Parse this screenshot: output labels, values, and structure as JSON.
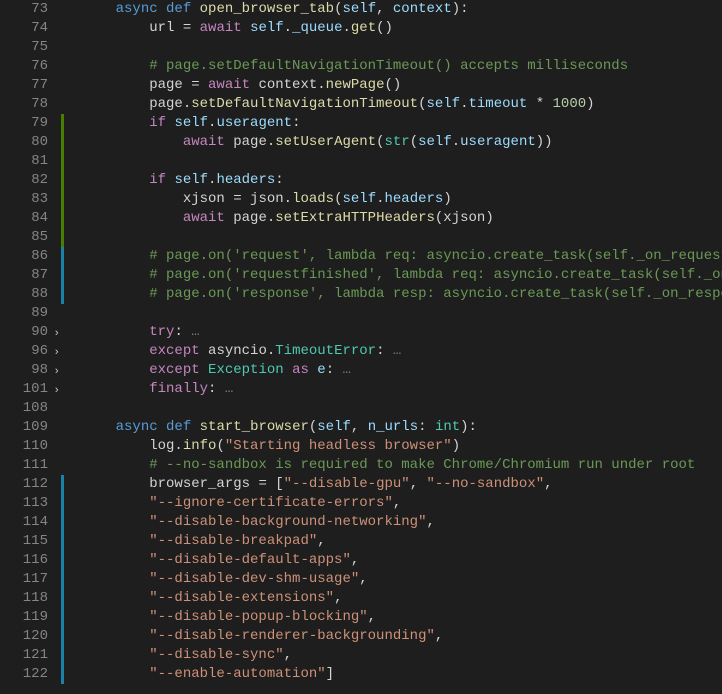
{
  "lines": [
    {
      "num": "73",
      "mod": null,
      "fold": false,
      "tokens": [
        {
          "t": "    ",
          "c": ""
        },
        {
          "t": "async",
          "c": "k-async"
        },
        {
          "t": " ",
          "c": ""
        },
        {
          "t": "def",
          "c": "k-def"
        },
        {
          "t": " ",
          "c": ""
        },
        {
          "t": "open_browser_tab",
          "c": "fn-name"
        },
        {
          "t": "(",
          "c": "punc"
        },
        {
          "t": "self",
          "c": "param"
        },
        {
          "t": ", ",
          "c": "punc"
        },
        {
          "t": "context",
          "c": "param"
        },
        {
          "t": "):",
          "c": "punc"
        }
      ]
    },
    {
      "num": "74",
      "mod": null,
      "fold": false,
      "tokens": [
        {
          "t": "        url ",
          "c": ""
        },
        {
          "t": "=",
          "c": "op"
        },
        {
          "t": " ",
          "c": ""
        },
        {
          "t": "await",
          "c": "k-ctrl"
        },
        {
          "t": " ",
          "c": ""
        },
        {
          "t": "self",
          "c": "k-self"
        },
        {
          "t": ".",
          "c": "punc"
        },
        {
          "t": "_queue",
          "c": "prop"
        },
        {
          "t": ".",
          "c": "punc"
        },
        {
          "t": "get",
          "c": "fn-call"
        },
        {
          "t": "()",
          "c": "punc"
        }
      ]
    },
    {
      "num": "75",
      "mod": null,
      "fold": false,
      "tokens": [
        {
          "t": "",
          "c": ""
        }
      ]
    },
    {
      "num": "76",
      "mod": null,
      "fold": false,
      "tokens": [
        {
          "t": "        ",
          "c": ""
        },
        {
          "t": "# page.setDefaultNavigationTimeout() accepts milliseconds",
          "c": "cmt"
        }
      ]
    },
    {
      "num": "77",
      "mod": null,
      "fold": false,
      "tokens": [
        {
          "t": "        page ",
          "c": ""
        },
        {
          "t": "=",
          "c": "op"
        },
        {
          "t": " ",
          "c": ""
        },
        {
          "t": "await",
          "c": "k-ctrl"
        },
        {
          "t": " context.",
          "c": ""
        },
        {
          "t": "newPage",
          "c": "fn-call"
        },
        {
          "t": "()",
          "c": "punc"
        }
      ]
    },
    {
      "num": "78",
      "mod": null,
      "fold": false,
      "tokens": [
        {
          "t": "        page.",
          "c": ""
        },
        {
          "t": "setDefaultNavigationTimeout",
          "c": "fn-call"
        },
        {
          "t": "(",
          "c": "punc"
        },
        {
          "t": "self",
          "c": "k-self"
        },
        {
          "t": ".",
          "c": "punc"
        },
        {
          "t": "timeout",
          "c": "prop"
        },
        {
          "t": " * ",
          "c": "op"
        },
        {
          "t": "1000",
          "c": "num"
        },
        {
          "t": ")",
          "c": "punc"
        }
      ]
    },
    {
      "num": "79",
      "mod": "green",
      "fold": false,
      "tokens": [
        {
          "t": "        ",
          "c": ""
        },
        {
          "t": "if",
          "c": "k-ctrl"
        },
        {
          "t": " ",
          "c": ""
        },
        {
          "t": "self",
          "c": "k-self"
        },
        {
          "t": ".",
          "c": "punc"
        },
        {
          "t": "useragent",
          "c": "prop"
        },
        {
          "t": ":",
          "c": "punc"
        }
      ]
    },
    {
      "num": "80",
      "mod": "green",
      "fold": false,
      "tokens": [
        {
          "t": "            ",
          "c": ""
        },
        {
          "t": "await",
          "c": "k-ctrl"
        },
        {
          "t": " page.",
          "c": ""
        },
        {
          "t": "setUserAgent",
          "c": "fn-call"
        },
        {
          "t": "(",
          "c": "punc"
        },
        {
          "t": "str",
          "c": "cls"
        },
        {
          "t": "(",
          "c": "punc"
        },
        {
          "t": "self",
          "c": "k-self"
        },
        {
          "t": ".",
          "c": "punc"
        },
        {
          "t": "useragent",
          "c": "prop"
        },
        {
          "t": "))",
          "c": "punc"
        }
      ]
    },
    {
      "num": "81",
      "mod": "green",
      "fold": false,
      "tokens": [
        {
          "t": "",
          "c": ""
        }
      ]
    },
    {
      "num": "82",
      "mod": "green",
      "fold": false,
      "tokens": [
        {
          "t": "        ",
          "c": ""
        },
        {
          "t": "if",
          "c": "k-ctrl"
        },
        {
          "t": " ",
          "c": ""
        },
        {
          "t": "self",
          "c": "k-self"
        },
        {
          "t": ".",
          "c": "punc"
        },
        {
          "t": "headers",
          "c": "prop"
        },
        {
          "t": ":",
          "c": "punc"
        }
      ]
    },
    {
      "num": "83",
      "mod": "green",
      "fold": false,
      "tokens": [
        {
          "t": "            xjson ",
          "c": ""
        },
        {
          "t": "=",
          "c": "op"
        },
        {
          "t": " json.",
          "c": ""
        },
        {
          "t": "loads",
          "c": "fn-call"
        },
        {
          "t": "(",
          "c": "punc"
        },
        {
          "t": "self",
          "c": "k-self"
        },
        {
          "t": ".",
          "c": "punc"
        },
        {
          "t": "headers",
          "c": "prop"
        },
        {
          "t": ")",
          "c": "punc"
        }
      ]
    },
    {
      "num": "84",
      "mod": "green",
      "fold": false,
      "tokens": [
        {
          "t": "            ",
          "c": ""
        },
        {
          "t": "await",
          "c": "k-ctrl"
        },
        {
          "t": " page.",
          "c": ""
        },
        {
          "t": "setExtraHTTPHeaders",
          "c": "fn-call"
        },
        {
          "t": "(xjson)",
          "c": "punc"
        }
      ]
    },
    {
      "num": "85",
      "mod": "green",
      "fold": false,
      "tokens": [
        {
          "t": "",
          "c": ""
        }
      ]
    },
    {
      "num": "86",
      "mod": "blue",
      "fold": false,
      "tokens": [
        {
          "t": "        ",
          "c": ""
        },
        {
          "t": "# page.on('request', lambda req: asyncio.create_task(self._on_request(",
          "c": "cmt"
        }
      ]
    },
    {
      "num": "87",
      "mod": "blue",
      "fold": false,
      "tokens": [
        {
          "t": "        ",
          "c": ""
        },
        {
          "t": "# page.on('requestfinished', lambda req: asyncio.create_task(self._on_",
          "c": "cmt"
        }
      ]
    },
    {
      "num": "88",
      "mod": "blue",
      "fold": false,
      "tokens": [
        {
          "t": "        ",
          "c": ""
        },
        {
          "t": "# page.on('response', lambda resp: asyncio.create_task(self._on_respons",
          "c": "cmt"
        }
      ]
    },
    {
      "num": "89",
      "mod": null,
      "fold": false,
      "tokens": [
        {
          "t": "",
          "c": ""
        }
      ]
    },
    {
      "num": "90",
      "mod": null,
      "fold": true,
      "tokens": [
        {
          "t": "        ",
          "c": ""
        },
        {
          "t": "try",
          "c": "k-ctrl"
        },
        {
          "t": ":",
          "c": "punc"
        },
        {
          "t": " …",
          "c": "collapse"
        }
      ]
    },
    {
      "num": "96",
      "mod": null,
      "fold": true,
      "tokens": [
        {
          "t": "        ",
          "c": ""
        },
        {
          "t": "except",
          "c": "k-ctrl"
        },
        {
          "t": " asyncio.",
          "c": ""
        },
        {
          "t": "TimeoutError",
          "c": "cls"
        },
        {
          "t": ":",
          "c": "punc"
        },
        {
          "t": " …",
          "c": "collapse"
        }
      ]
    },
    {
      "num": "98",
      "mod": null,
      "fold": true,
      "tokens": [
        {
          "t": "        ",
          "c": ""
        },
        {
          "t": "except",
          "c": "k-ctrl"
        },
        {
          "t": " ",
          "c": ""
        },
        {
          "t": "Exception",
          "c": "cls"
        },
        {
          "t": " ",
          "c": ""
        },
        {
          "t": "as",
          "c": "k-ctrl"
        },
        {
          "t": " ",
          "c": ""
        },
        {
          "t": "e",
          "c": "param"
        },
        {
          "t": ":",
          "c": "punc"
        },
        {
          "t": " …",
          "c": "collapse"
        }
      ]
    },
    {
      "num": "101",
      "mod": null,
      "fold": true,
      "tokens": [
        {
          "t": "        ",
          "c": ""
        },
        {
          "t": "finally",
          "c": "k-ctrl"
        },
        {
          "t": ":",
          "c": "punc"
        },
        {
          "t": " …",
          "c": "collapse"
        }
      ]
    },
    {
      "num": "108",
      "mod": null,
      "fold": false,
      "tokens": [
        {
          "t": "",
          "c": ""
        }
      ]
    },
    {
      "num": "109",
      "mod": null,
      "fold": false,
      "tokens": [
        {
          "t": "    ",
          "c": ""
        },
        {
          "t": "async",
          "c": "k-async"
        },
        {
          "t": " ",
          "c": ""
        },
        {
          "t": "def",
          "c": "k-def"
        },
        {
          "t": " ",
          "c": ""
        },
        {
          "t": "start_browser",
          "c": "fn-name"
        },
        {
          "t": "(",
          "c": "punc"
        },
        {
          "t": "self",
          "c": "param"
        },
        {
          "t": ", ",
          "c": "punc"
        },
        {
          "t": "n_urls",
          "c": "param"
        },
        {
          "t": ": ",
          "c": "punc"
        },
        {
          "t": "int",
          "c": "cls"
        },
        {
          "t": "):",
          "c": "punc"
        }
      ]
    },
    {
      "num": "110",
      "mod": null,
      "fold": false,
      "tokens": [
        {
          "t": "        log.",
          "c": ""
        },
        {
          "t": "info",
          "c": "fn-call"
        },
        {
          "t": "(",
          "c": "punc"
        },
        {
          "t": "\"Starting headless browser\"",
          "c": "str"
        },
        {
          "t": ")",
          "c": "punc"
        }
      ]
    },
    {
      "num": "111",
      "mod": null,
      "fold": false,
      "tokens": [
        {
          "t": "        ",
          "c": ""
        },
        {
          "t": "# --no-sandbox is required to make Chrome/Chromium run under root",
          "c": "cmt"
        }
      ]
    },
    {
      "num": "112",
      "mod": "blue",
      "fold": false,
      "tokens": [
        {
          "t": "        browser_args ",
          "c": ""
        },
        {
          "t": "=",
          "c": "op"
        },
        {
          "t": " [",
          "c": "punc"
        },
        {
          "t": "\"--disable-gpu\"",
          "c": "str"
        },
        {
          "t": ", ",
          "c": "punc"
        },
        {
          "t": "\"--no-sandbox\"",
          "c": "str"
        },
        {
          "t": ",",
          "c": "punc"
        }
      ]
    },
    {
      "num": "113",
      "mod": "blue",
      "fold": false,
      "tokens": [
        {
          "t": "        ",
          "c": ""
        },
        {
          "t": "\"--ignore-certificate-errors\"",
          "c": "str"
        },
        {
          "t": ",",
          "c": "punc"
        }
      ]
    },
    {
      "num": "114",
      "mod": "blue",
      "fold": false,
      "tokens": [
        {
          "t": "        ",
          "c": ""
        },
        {
          "t": "\"--disable-background-networking\"",
          "c": "str"
        },
        {
          "t": ",",
          "c": "punc"
        }
      ]
    },
    {
      "num": "115",
      "mod": "blue",
      "fold": false,
      "tokens": [
        {
          "t": "        ",
          "c": ""
        },
        {
          "t": "\"--disable-breakpad\"",
          "c": "str"
        },
        {
          "t": ",",
          "c": "punc"
        }
      ]
    },
    {
      "num": "116",
      "mod": "blue",
      "fold": false,
      "tokens": [
        {
          "t": "        ",
          "c": ""
        },
        {
          "t": "\"--disable-default-apps\"",
          "c": "str"
        },
        {
          "t": ",",
          "c": "punc"
        }
      ]
    },
    {
      "num": "117",
      "mod": "blue",
      "fold": false,
      "tokens": [
        {
          "t": "        ",
          "c": ""
        },
        {
          "t": "\"--disable-dev-shm-usage\"",
          "c": "str"
        },
        {
          "t": ",",
          "c": "punc"
        }
      ]
    },
    {
      "num": "118",
      "mod": "blue",
      "fold": false,
      "tokens": [
        {
          "t": "        ",
          "c": ""
        },
        {
          "t": "\"--disable-extensions\"",
          "c": "str"
        },
        {
          "t": ",",
          "c": "punc"
        }
      ]
    },
    {
      "num": "119",
      "mod": "blue",
      "fold": false,
      "tokens": [
        {
          "t": "        ",
          "c": ""
        },
        {
          "t": "\"--disable-popup-blocking\"",
          "c": "str"
        },
        {
          "t": ",",
          "c": "punc"
        }
      ]
    },
    {
      "num": "120",
      "mod": "blue",
      "fold": false,
      "tokens": [
        {
          "t": "        ",
          "c": ""
        },
        {
          "t": "\"--disable-renderer-backgrounding\"",
          "c": "str"
        },
        {
          "t": ",",
          "c": "punc"
        }
      ]
    },
    {
      "num": "121",
      "mod": "blue",
      "fold": false,
      "tokens": [
        {
          "t": "        ",
          "c": ""
        },
        {
          "t": "\"--disable-sync\"",
          "c": "str"
        },
        {
          "t": ",",
          "c": "punc"
        }
      ]
    },
    {
      "num": "122",
      "mod": "blue",
      "fold": false,
      "tokens": [
        {
          "t": "        ",
          "c": ""
        },
        {
          "t": "\"--enable-automation\"",
          "c": "str"
        },
        {
          "t": "]",
          "c": "punc"
        }
      ]
    }
  ]
}
